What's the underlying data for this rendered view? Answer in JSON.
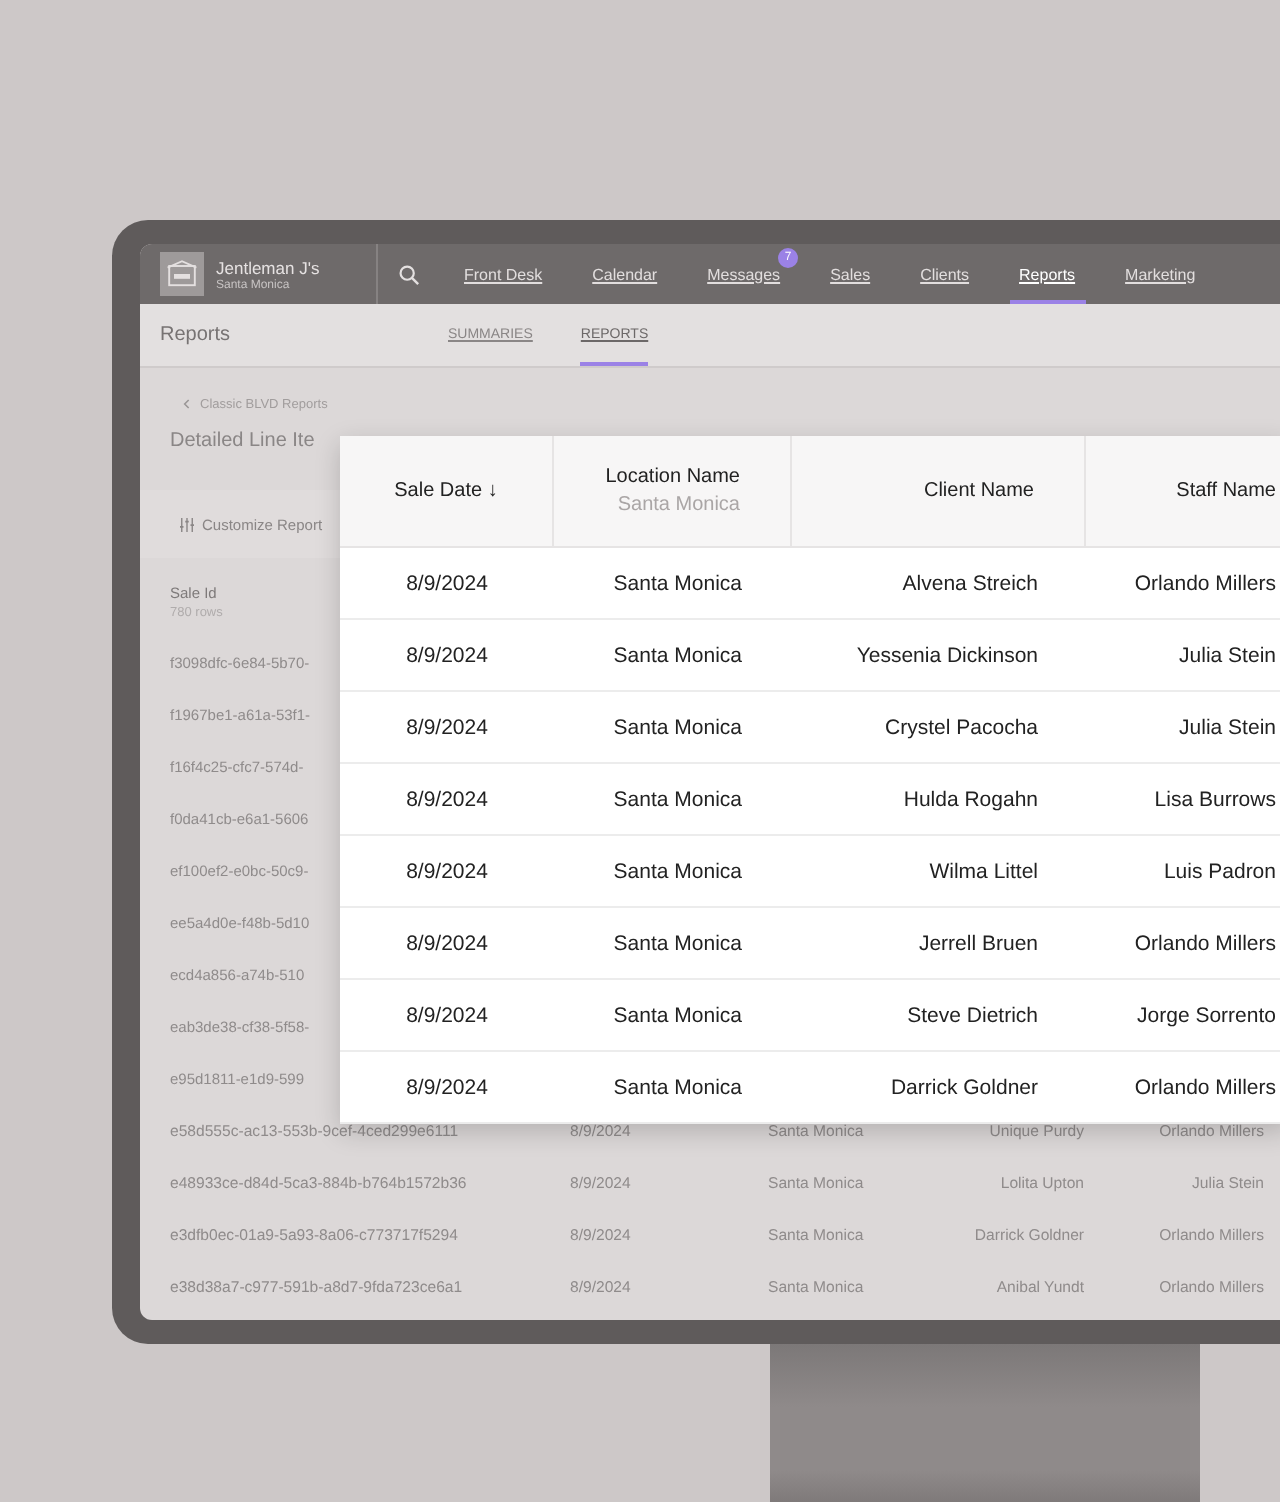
{
  "app_bar": {
    "business_name": "Jentleman J's",
    "location": "Santa Monica",
    "nav": [
      {
        "label": "Front Desk",
        "selected": false
      },
      {
        "label": "Calendar",
        "selected": false
      },
      {
        "label": "Messages",
        "selected": false,
        "badge": "7"
      },
      {
        "label": "Sales",
        "selected": false
      },
      {
        "label": "Clients",
        "selected": false
      },
      {
        "label": "Reports",
        "selected": true
      },
      {
        "label": "Marketing",
        "selected": false
      }
    ]
  },
  "page": {
    "title": "Reports",
    "tabs": [
      {
        "label": "SUMMARIES",
        "selected": false
      },
      {
        "label": "REPORTS",
        "selected": true
      }
    ],
    "breadcrumb": "Classic BLVD Reports",
    "report_title": "Detailed Line Ite",
    "customize_button": "Customize Report"
  },
  "background_table": {
    "column": "Sale Id",
    "row_count": "780 rows",
    "covered_rows": [
      "f3098dfc-6e84-5b70-",
      "f1967be1-a61a-53f1-",
      "f16f4c25-cfc7-574d-",
      "f0da41cb-e6a1-5606",
      "ef100ef2-e0bc-50c9-",
      "ee5a4d0e-f48b-5d10",
      "ecd4a856-a74b-510",
      "eab3de38-cf38-5f58-",
      "e95d1811-e1d9-599"
    ],
    "rows": [
      [
        "e58d555c-ac13-553b-9cef-4ced299e6111",
        "8/9/2024",
        "Santa Monica",
        "Unique Purdy",
        "Orlando Millers"
      ],
      [
        "e48933ce-d84d-5ca3-884b-b764b1572b36",
        "8/9/2024",
        "Santa Monica",
        "Lolita Upton",
        "Julia Stein"
      ],
      [
        "e3dfb0ec-01a9-5a93-8a06-c773717f5294",
        "8/9/2024",
        "Santa Monica",
        "Darrick Goldner",
        "Orlando Millers"
      ],
      [
        "e38d38a7-c977-591b-a8d7-9fda723ce6a1",
        "8/9/2024",
        "Santa Monica",
        "Anibal Yundt",
        "Orlando Millers"
      ]
    ]
  },
  "overlay_table": {
    "columns": [
      {
        "label": "Sale Date",
        "sort": "↓"
      },
      {
        "label": "Location Name",
        "filter": "Santa Monica"
      },
      {
        "label": "Client Name"
      },
      {
        "label": "Staff Name"
      }
    ],
    "rows": [
      [
        "8/9/2024",
        "Santa Monica",
        "Alvena Streich",
        "Orlando Millers"
      ],
      [
        "8/9/2024",
        "Santa Monica",
        "Yessenia Dickinson",
        "Julia Stein"
      ],
      [
        "8/9/2024",
        "Santa Monica",
        "Crystel Pacocha",
        "Julia Stein"
      ],
      [
        "8/9/2024",
        "Santa Monica",
        "Hulda Rogahn",
        "Lisa Burrows"
      ],
      [
        "8/9/2024",
        "Santa Monica",
        "Wilma Littel",
        "Luis Padron"
      ],
      [
        "8/9/2024",
        "Santa Monica",
        "Jerrell Bruen",
        "Orlando Millers"
      ],
      [
        "8/9/2024",
        "Santa Monica",
        "Steve Dietrich",
        "Jorge Sorrento"
      ],
      [
        "8/9/2024",
        "Santa Monica",
        "Darrick Goldner",
        "Orlando Millers"
      ]
    ]
  }
}
